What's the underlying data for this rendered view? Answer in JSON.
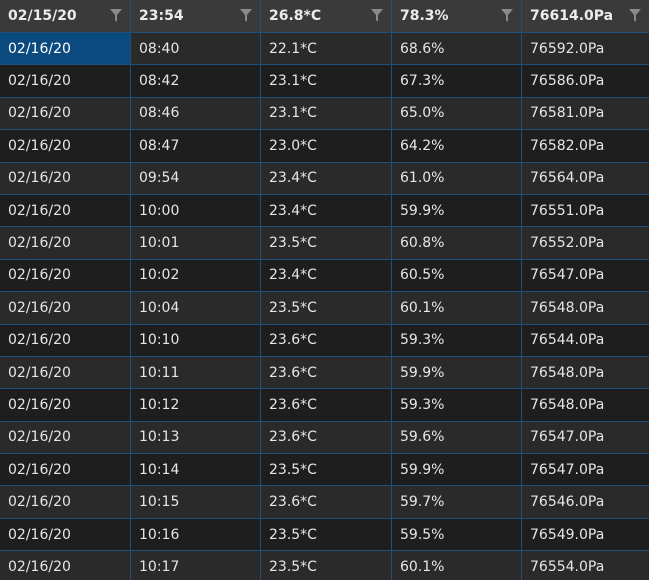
{
  "columns": [
    {
      "label": "02/15/20",
      "icon": "filter-icon"
    },
    {
      "label": "23:54",
      "icon": "filter-icon"
    },
    {
      "label": "26.8*C",
      "icon": "filter-icon"
    },
    {
      "label": "78.3%",
      "icon": "filter-icon"
    },
    {
      "label": "76614.0Pa",
      "icon": "filter-icon"
    }
  ],
  "rows": [
    [
      "02/16/20",
      "08:40",
      "22.1*C",
      "68.6%",
      "76592.0Pa"
    ],
    [
      "02/16/20",
      "08:42",
      "23.1*C",
      "67.3%",
      "76586.0Pa"
    ],
    [
      "02/16/20",
      "08:46",
      "23.1*C",
      "65.0%",
      "76581.0Pa"
    ],
    [
      "02/16/20",
      "08:47",
      "23.0*C",
      "64.2%",
      "76582.0Pa"
    ],
    [
      "02/16/20",
      "09:54",
      "23.4*C",
      "61.0%",
      "76564.0Pa"
    ],
    [
      "02/16/20",
      "10:00",
      "23.4*C",
      "59.9%",
      "76551.0Pa"
    ],
    [
      "02/16/20",
      "10:01",
      "23.5*C",
      "60.8%",
      "76552.0Pa"
    ],
    [
      "02/16/20",
      "10:02",
      "23.4*C",
      "60.5%",
      "76547.0Pa"
    ],
    [
      "02/16/20",
      "10:04",
      "23.5*C",
      "60.1%",
      "76548.0Pa"
    ],
    [
      "02/16/20",
      "10:10",
      "23.6*C",
      "59.3%",
      "76544.0Pa"
    ],
    [
      "02/16/20",
      "10:11",
      "23.6*C",
      "59.9%",
      "76548.0Pa"
    ],
    [
      "02/16/20",
      "10:12",
      "23.6*C",
      "59.3%",
      "76548.0Pa"
    ],
    [
      "02/16/20",
      "10:13",
      "23.6*C",
      "59.6%",
      "76547.0Pa"
    ],
    [
      "02/16/20",
      "10:14",
      "23.5*C",
      "59.9%",
      "76547.0Pa"
    ],
    [
      "02/16/20",
      "10:15",
      "23.6*C",
      "59.7%",
      "76546.0Pa"
    ],
    [
      "02/16/20",
      "10:16",
      "23.5*C",
      "59.5%",
      "76549.0Pa"
    ],
    [
      "02/16/20",
      "10:17",
      "23.5*C",
      "60.1%",
      "76554.0Pa"
    ]
  ],
  "selected_cell": {
    "row": 0,
    "col": 0
  },
  "colors": {
    "header_bg": "#3a3a3a",
    "grid_line": "#1f4f7a",
    "selected_bg": "#0b4a7f",
    "row_odd": "#2a2a2a",
    "row_even": "#1e1e1e"
  }
}
